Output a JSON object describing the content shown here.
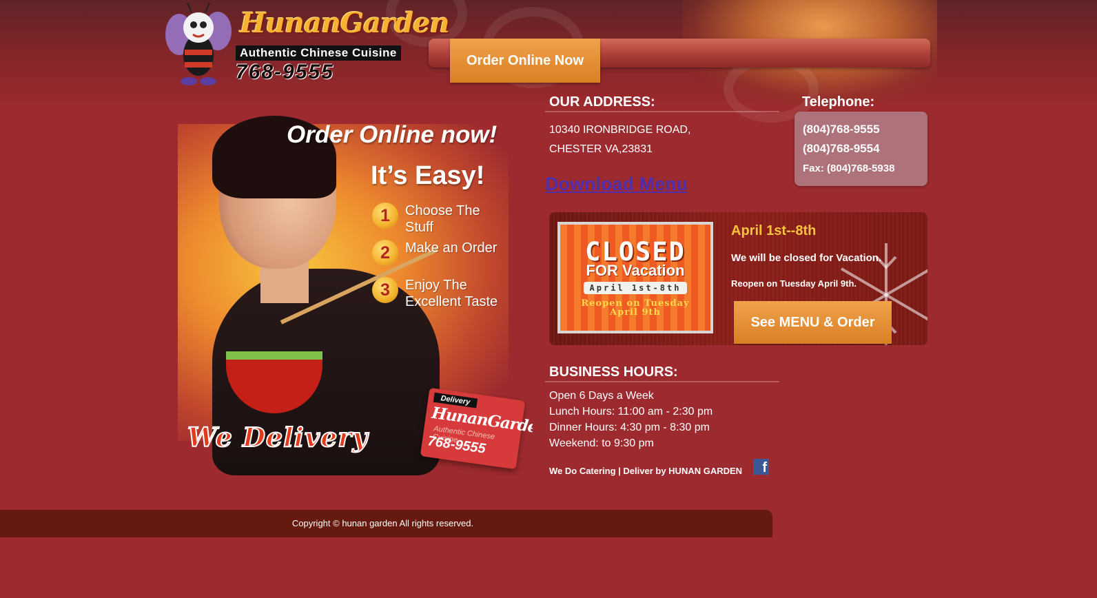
{
  "header": {
    "brand_name": "HunanGarden",
    "tagline": "Authentic Chinese Cuisine",
    "phone_short": "768-9555",
    "order_button": "Order Online Now"
  },
  "promo": {
    "title": "Order Online now!",
    "subtitle": "It’s Easy!",
    "steps": [
      {
        "num": "1",
        "text": "Choose The Stuff"
      },
      {
        "num": "2",
        "text": "Make an Order"
      },
      {
        "num": "3",
        "text": "Enjoy The Excellent Taste"
      }
    ],
    "we_deliver": "We Delivery",
    "box_label": "Delivery",
    "box_name": "HunanGarden",
    "box_tag": "Authentic Chinese Cuisine",
    "box_phone": "768-9555"
  },
  "address": {
    "heading": "OUR ADDRESS:",
    "line1": "10340 IRONBRIDGE ROAD,",
    "line2": "CHESTER VA,23831"
  },
  "telephone": {
    "heading": "Telephone:",
    "phone1": "(804)768-9555",
    "phone2": "(804)768-9554",
    "fax": "Fax: (804)768-5938"
  },
  "download_menu": "Download Menu",
  "vacation": {
    "sign_closed": "CLOSED",
    "sign_for": "FOR Vacation",
    "sign_date": "April 1st-8th",
    "sign_reopen_1": "Reopen on Tuesday",
    "sign_reopen_2": "April 9th",
    "date": "April 1st--8th",
    "message": "We will be closed for Vacation.",
    "reopen": "Reopen on Tuesday April 9th.",
    "button": "See MENU & Order"
  },
  "hours": {
    "heading": "BUSINESS HOURS:",
    "lines": [
      "Open 6 Days a Week",
      "Lunch Hours: 11:00 am - 2:30 pm",
      "Dinner Hours: 4:30 pm - 8:30 pm",
      "Weekend: to 9:30 pm"
    ],
    "catering": "We Do Catering | Deliver by HUNAN GARDEN"
  },
  "footer": {
    "copyright": "Copyright © hunan garden All rights reserved."
  },
  "icons": {
    "facebook": "facebook-icon"
  },
  "colors": {
    "page_bg": "#9c2a2e",
    "accent_orange": "#e08a2f",
    "gold": "#f7c23d",
    "link_purple": "#4f2fae",
    "footer_bg": "#66190f",
    "facebook_blue": "#3b5998"
  }
}
